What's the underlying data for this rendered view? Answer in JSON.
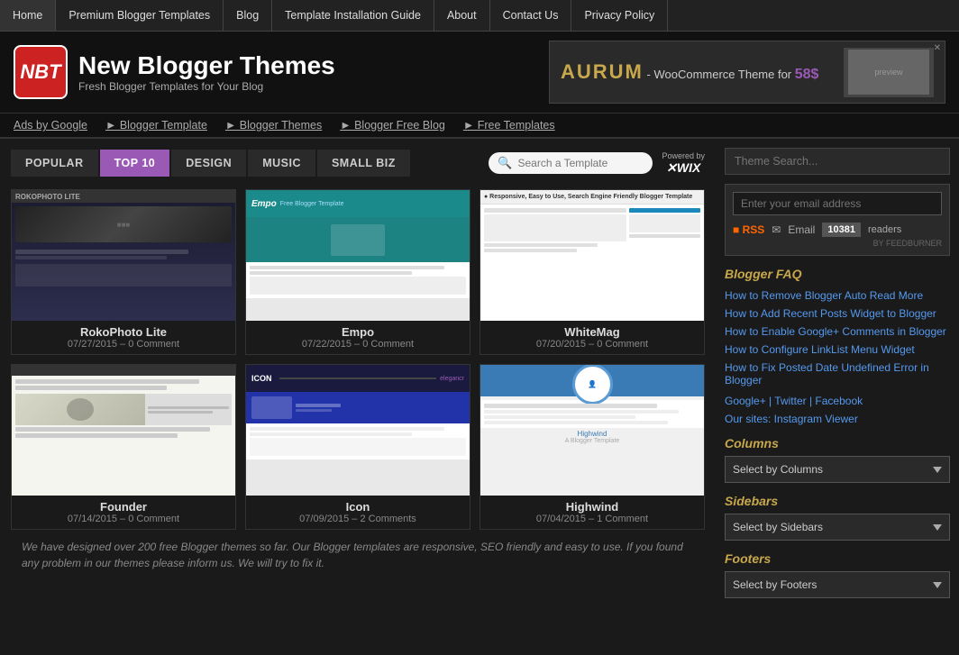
{
  "nav": {
    "items": [
      {
        "label": "Home",
        "id": "home"
      },
      {
        "label": "Premium Blogger Templates",
        "id": "premium"
      },
      {
        "label": "Blog",
        "id": "blog"
      },
      {
        "label": "Template Installation Guide",
        "id": "guide"
      },
      {
        "label": "About",
        "id": "about"
      },
      {
        "label": "Contact Us",
        "id": "contact"
      },
      {
        "label": "Privacy Policy",
        "id": "privacy"
      }
    ]
  },
  "header": {
    "logo_text": "NBT",
    "site_title": "New Blogger Themes",
    "site_tagline": "Fresh Blogger Templates for Your Blog",
    "ad_brand": "AURUM",
    "ad_dash": " - ",
    "ad_desc": "WooCommerce Theme for",
    "ad_price": "58$",
    "ad_close": "✕"
  },
  "secondary_nav": {
    "items": [
      {
        "label": "Ads by Google",
        "id": "ads-google"
      },
      {
        "label": "► Blogger Template",
        "id": "blogger-template"
      },
      {
        "label": "► Blogger Themes",
        "id": "blogger-themes"
      },
      {
        "label": "► Blogger Free Blog",
        "id": "free-blog"
      },
      {
        "label": "► Free Templates",
        "id": "free-templates"
      }
    ]
  },
  "tabs": {
    "items": [
      {
        "label": "POPULAR",
        "id": "popular",
        "active": false
      },
      {
        "label": "TOP 10",
        "id": "top10",
        "active": true
      },
      {
        "label": "DESIGN",
        "id": "design",
        "active": false
      },
      {
        "label": "MUSIC",
        "id": "music",
        "active": false
      },
      {
        "label": "SMALL BIZ",
        "id": "smallbiz",
        "active": false
      }
    ],
    "search_placeholder": "Search a Template",
    "powered_by": "Powered by",
    "wix_label": "✕WIX"
  },
  "templates": [
    {
      "name": "RokoPhoto Lite",
      "date": "07/27/2015 – 0 Comment",
      "thumb_style": "thumb-dark",
      "id": "rokophoto"
    },
    {
      "name": "Empo",
      "date": "07/22/2015 – 0 Comment",
      "thumb_style": "thumb-teal",
      "id": "empo"
    },
    {
      "name": "WhiteMag",
      "date": "07/20/2015 – 0 Comment",
      "thumb_style": "thumb-white",
      "id": "whitemag"
    },
    {
      "name": "Founder",
      "date": "07/14/2015 – 0 Comment",
      "thumb_style": "thumb-founder",
      "id": "founder"
    },
    {
      "name": "Icon",
      "date": "07/09/2015 – 2 Comments",
      "thumb_style": "thumb-icon",
      "id": "icon"
    },
    {
      "name": "Highwind",
      "date": "07/04/2015 – 1 Comment",
      "thumb_style": "thumb-highwind",
      "id": "highwind"
    }
  ],
  "footer_text": "We have designed over 200 free Blogger themes so far. Our Blogger templates are responsive, SEO friendly and easy to use. If you found any problem in our themes please inform us. We will try to fix it.",
  "sidebar": {
    "search_placeholder": "Theme Search...",
    "email_placeholder": "Enter your email address",
    "rss_label": "RSS",
    "email_label": "Email",
    "reader_count": "10381",
    "readers_label": "readers",
    "feedburner_label": "BY FEEDBURNER",
    "faq_title": "Blogger FAQ",
    "faq_items": [
      "How to Remove Blogger Auto Read More",
      "How to Add Recent Posts Widget to Blogger",
      "How to Enable Google+ Comments in Blogger",
      "How to Configure LinkList Menu Widget",
      "How to Fix Posted Date Undefined Error in Blogger"
    ],
    "social_text": "Google+ | Twitter | Facebook",
    "our_sites": "Our sites: Instagram Viewer",
    "columns_title": "Columns",
    "columns_default": "Select by Columns",
    "sidebars_title": "Sidebars",
    "sidebars_default": "Select by Sidebars",
    "footers_title": "Footers",
    "footers_default": "Select by Footers"
  }
}
